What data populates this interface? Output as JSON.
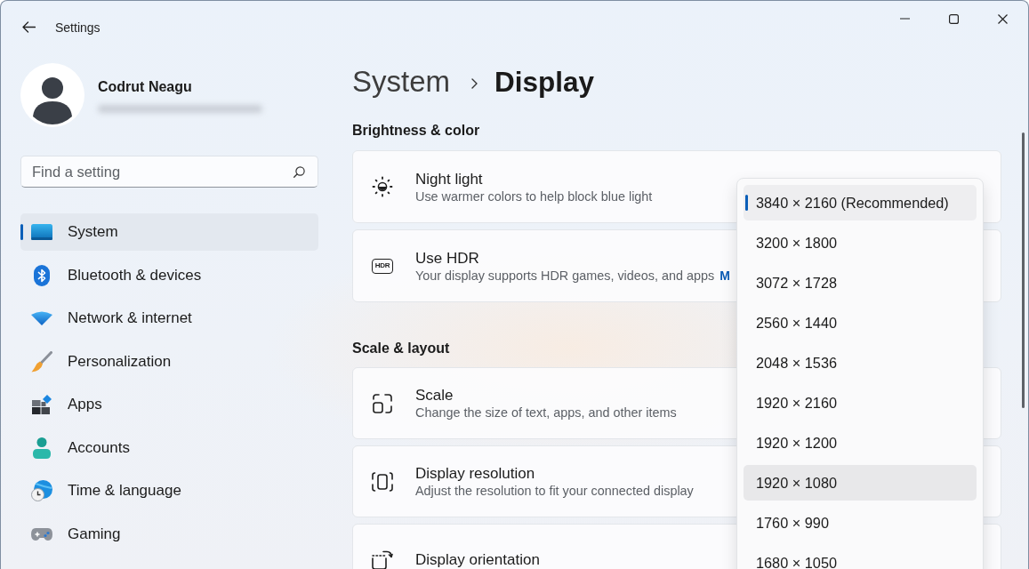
{
  "window": {
    "title": "Settings"
  },
  "profile": {
    "name": "Codrut Neagu"
  },
  "search": {
    "placeholder": "Find a setting"
  },
  "sidebar": {
    "items": [
      {
        "label": "System",
        "selected": true
      },
      {
        "label": "Bluetooth & devices",
        "selected": false
      },
      {
        "label": "Network & internet",
        "selected": false
      },
      {
        "label": "Personalization",
        "selected": false
      },
      {
        "label": "Apps",
        "selected": false
      },
      {
        "label": "Accounts",
        "selected": false
      },
      {
        "label": "Time & language",
        "selected": false
      },
      {
        "label": "Gaming",
        "selected": false
      }
    ]
  },
  "breadcrumb": {
    "parent": "System",
    "current": "Display"
  },
  "sections": [
    {
      "title": "Brightness & color",
      "cards": [
        {
          "title": "Night light",
          "description": "Use warmer colors to help block blue light"
        },
        {
          "badge": "HDR",
          "title": "Use HDR",
          "description": "Your display supports HDR games, videos, and apps",
          "link": "M"
        }
      ]
    },
    {
      "title": "Scale & layout",
      "cards": [
        {
          "title": "Scale",
          "description": "Change the size of text, apps, and other items"
        },
        {
          "title": "Display resolution",
          "description": "Adjust the resolution to fit your connected display"
        },
        {
          "title": "Display orientation"
        }
      ]
    }
  ],
  "resolution_dropdown": {
    "options": [
      {
        "label": "3840 × 2160 (Recommended)",
        "selected": true,
        "hovered": false
      },
      {
        "label": "3200 × 1800",
        "selected": false,
        "hovered": false
      },
      {
        "label": "3072 × 1728",
        "selected": false,
        "hovered": false
      },
      {
        "label": "2560 × 1440",
        "selected": false,
        "hovered": false
      },
      {
        "label": "2048 × 1536",
        "selected": false,
        "hovered": false
      },
      {
        "label": "1920 × 2160",
        "selected": false,
        "hovered": false
      },
      {
        "label": "1920 × 1200",
        "selected": false,
        "hovered": false
      },
      {
        "label": "1920 × 1080",
        "selected": false,
        "hovered": true
      },
      {
        "label": "1760 × 990",
        "selected": false,
        "hovered": false
      },
      {
        "label": "1680 × 1050",
        "selected": false,
        "hovered": false
      }
    ]
  }
}
